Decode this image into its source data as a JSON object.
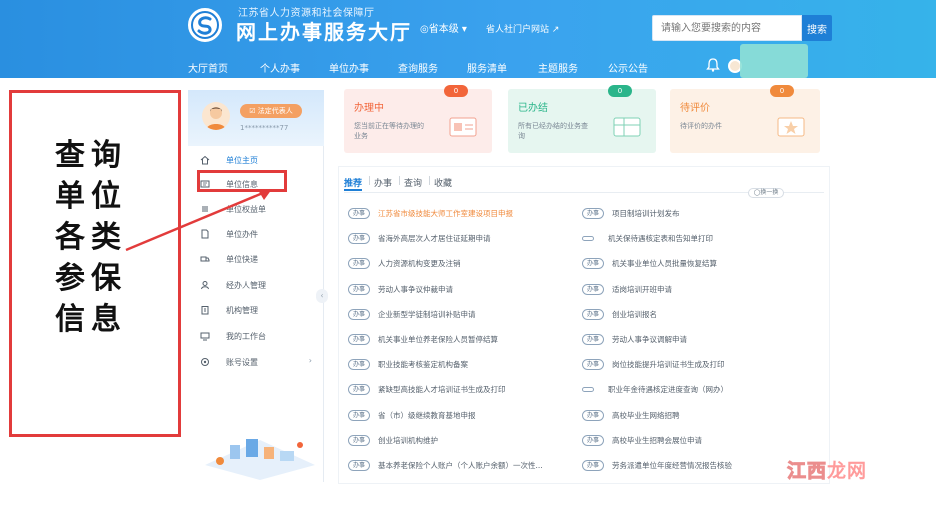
{
  "header": {
    "org": "江苏省人力资源和社会保障厅",
    "title": "网上办事服务大厅",
    "region": "◎省本级 ▾",
    "portal_link": "省人社门户网站 ↗",
    "search_placeholder": "请输入您要搜索的内容",
    "search_button": "搜索"
  },
  "nav": [
    {
      "label": "大厅首页"
    },
    {
      "label": "个人办事"
    },
    {
      "label": "单位办事"
    },
    {
      "label": "查询服务"
    },
    {
      "label": "服务清单"
    },
    {
      "label": "主题服务"
    },
    {
      "label": "公示公告"
    }
  ],
  "annotation": {
    "lines": [
      "查询",
      "单位",
      "各类",
      "参保",
      "信息"
    ],
    "colors": {
      "box": "#e23b3b"
    }
  },
  "profile": {
    "badge": "☑ 法定代表人",
    "phone": "1**********77"
  },
  "sidebar": {
    "items": [
      {
        "label": "单位主页",
        "icon": "home-icon"
      },
      {
        "label": "单位信息",
        "icon": "id-card-icon"
      },
      {
        "label": "单位权益单",
        "icon": "list-icon"
      },
      {
        "label": "单位办件",
        "icon": "file-icon"
      },
      {
        "label": "单位快递",
        "icon": "truck-icon"
      },
      {
        "label": "经办人管理",
        "icon": "user-icon"
      },
      {
        "label": "机构管理",
        "icon": "building-icon"
      },
      {
        "label": "我的工作台",
        "icon": "desk-icon"
      },
      {
        "label": "账号设置",
        "icon": "gear-icon",
        "chevron": "›"
      }
    ],
    "collapse": "‹"
  },
  "cards": [
    {
      "title": "办理中",
      "desc": "您当前正在等待办理的业务",
      "count": "0",
      "color": "#f2653a",
      "bg": "#fdecea"
    },
    {
      "title": "已办结",
      "desc": "所有已经办结的业务查询",
      "count": "0",
      "color": "#2ab58a",
      "bg": "#e6f6f0"
    },
    {
      "title": "待评价",
      "desc": "待评价的办件",
      "count": "0",
      "color": "#f08a3c",
      "bg": "#fdf1e6"
    }
  ],
  "tabs": [
    {
      "label": "推荐",
      "sep": ""
    },
    {
      "label": "办事",
      "sep": "|"
    },
    {
      "label": "查询",
      "sep": "|"
    },
    {
      "label": "收藏",
      "sep": "|"
    }
  ],
  "swap_label": "◯换一换",
  "services": {
    "tag": "办事",
    "left": [
      {
        "name": "江苏省市级技能大师工作室建设项目申报",
        "hot": true
      },
      {
        "name": "省海外高层次人才居住证延期申请"
      },
      {
        "name": "人力资源机构变更及注销"
      },
      {
        "name": "劳动人事争议仲裁申请"
      },
      {
        "name": "企业新型学徒制培训补贴申请"
      },
      {
        "name": "机关事业单位养老保险人员暂停结算"
      },
      {
        "name": "职业技能考核鉴定机构备案"
      },
      {
        "name": "紧缺型高技能人才培训证书生成及打印"
      },
      {
        "name": "省（市）级继续教育基地申报"
      },
      {
        "name": "创业培训机构维护"
      },
      {
        "name": "基本养老保险个人账户（个人账户余额）一次性..."
      }
    ],
    "right": [
      {
        "name": "项目制培训计划发布",
        "tag": true
      },
      {
        "name": "机关保待遇核定表和告知单打印",
        "tag": false
      },
      {
        "name": "机关事业单位人员批量恢复结算",
        "tag": true
      },
      {
        "name": "适岗培训开班申请",
        "tag": true
      },
      {
        "name": "创业培训报名",
        "tag": true
      },
      {
        "name": "劳动人事争议调解申请",
        "tag": true
      },
      {
        "name": "岗位技能提升培训证书生成及打印",
        "tag": true
      },
      {
        "name": "职业年金待遇核定进度查询（网办）",
        "tag": false
      },
      {
        "name": "高校毕业生网络招聘",
        "tag": true
      },
      {
        "name": "高校毕业生招聘会展位申请",
        "tag": true
      },
      {
        "name": "劳务派遣单位年度经营情况报告核验",
        "tag": true
      }
    ]
  },
  "watermark": {
    "cn": "江西",
    "rest": "龙网"
  },
  "colors": {
    "header": "#2a8fe0",
    "accent": "#1f7fd6",
    "red": "#e23b3b"
  }
}
